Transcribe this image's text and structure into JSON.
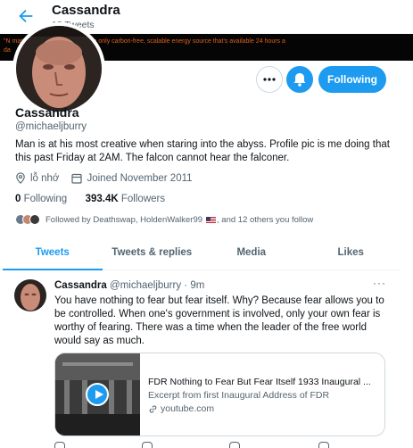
{
  "header": {
    "title": "Cassandra",
    "subtitle": "18 Tweets"
  },
  "banner": {
    "text": "\"N                                    mate change, because it is the only carbon-free, scalable energy source that's available 24 hours a",
    "text2": "da"
  },
  "profile": {
    "name": "Cassandra",
    "handle": "@michaeljburry",
    "bio": "Man is at his most creative when staring into the abyss. Profile pic is me doing that this past Friday at 2AM. The falcon cannot hear the falconer.",
    "location": "lỗ nhớ",
    "joined": "Joined November 2011",
    "following_count": "0",
    "following_label": "Following",
    "followers_count": "393.4K",
    "followers_label": "Followers",
    "followed_by": "Followed by Deathswap, HoldenWalker99",
    "followed_by_tail": ", and 12 others you follow",
    "follow_button": "Following"
  },
  "tabs": [
    {
      "label": "Tweets",
      "active": true
    },
    {
      "label": "Tweets & replies",
      "active": false
    },
    {
      "label": "Media",
      "active": false
    },
    {
      "label": "Likes",
      "active": false
    }
  ],
  "tweet": {
    "name": "Cassandra",
    "handle": "@michaeljburry",
    "sep": "·",
    "time": "9m",
    "more": "···",
    "text": "You have nothing to fear but fear itself. Why? Because fear allows you to be controlled. When one's government is involved, only your own fear is worthy of fearing. There was a time when the leader of the free world would say as much.",
    "card": {
      "title": "FDR Nothing to Fear But Fear Itself 1933 Inaugural ...",
      "description": "Excerpt from first Inaugural Address of FDR",
      "domain": "youtube.com"
    }
  },
  "colors": {
    "accent": "#1d9bf0",
    "text": "#0f1419",
    "muted": "#536471",
    "banner_text": "#e0601a"
  },
  "icons": [
    "back-arrow-icon",
    "more-icon",
    "bell-icon",
    "location-icon",
    "calendar-icon",
    "link-icon",
    "play-icon",
    "us-flag-icon"
  ]
}
